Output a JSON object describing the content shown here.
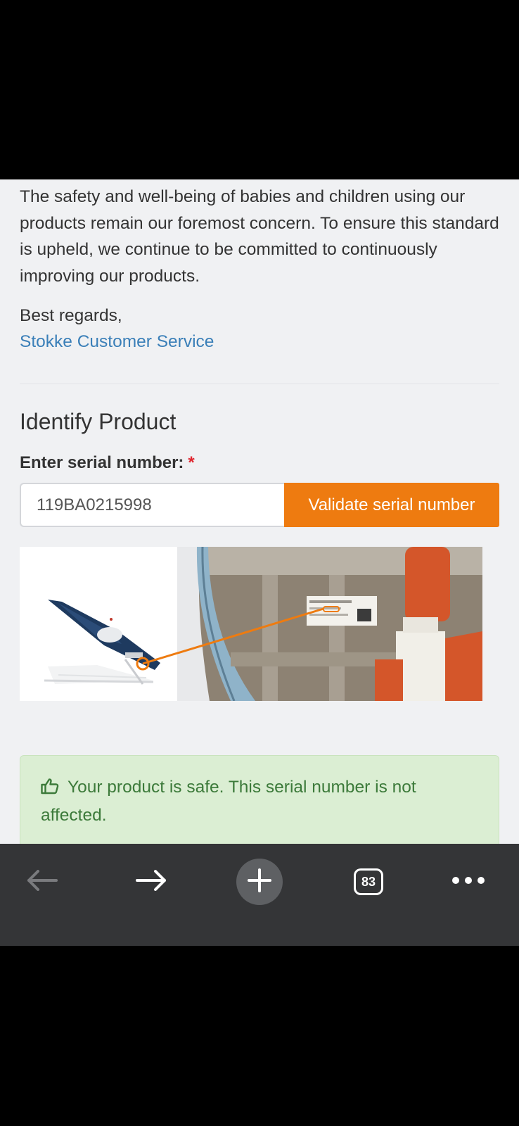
{
  "body_text": "The safety and well-being of babies and children using our products remain our foremost concern. To ensure this standard is upheld, we continue to be committed to continuously improving our products.",
  "closing": "Best regards,",
  "signature": "Stokke Customer Service",
  "identify": {
    "heading": "Identify Product",
    "field_label": "Enter serial number:",
    "required_marker": "*",
    "serial_value": "119BA0215998",
    "validate_label": "Validate serial number"
  },
  "result": {
    "message": "Your product is safe. This serial number is not affected.",
    "icon": "thumbs-up-icon"
  },
  "browser_toolbar": {
    "tab_count": "83",
    "icons": [
      "back-arrow-icon",
      "forward-arrow-icon",
      "plus-icon",
      "tabs-icon",
      "more-icon"
    ]
  },
  "colors": {
    "accent": "#ee7b10",
    "link": "#3a7fb8",
    "success_bg": "#dbeed3",
    "success_text": "#3c7a3a",
    "required": "#e0262f"
  }
}
